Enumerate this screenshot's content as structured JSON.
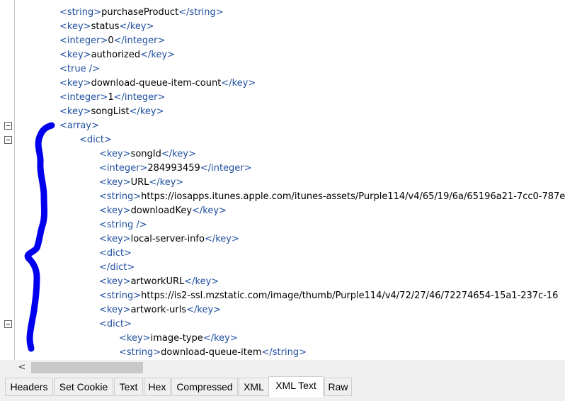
{
  "lines": [
    {
      "kind": "pair",
      "tag": "string",
      "text": "purchaseProduct"
    },
    {
      "kind": "pair",
      "tag": "key",
      "text": "status"
    },
    {
      "kind": "pair",
      "tag": "integer",
      "text": "0"
    },
    {
      "kind": "pair",
      "tag": "key",
      "text": "authorized"
    },
    {
      "kind": "self",
      "tag": "true"
    },
    {
      "kind": "pair",
      "tag": "key",
      "text": "download-queue-item-count"
    },
    {
      "kind": "pair",
      "tag": "integer",
      "text": "1"
    },
    {
      "kind": "pair",
      "tag": "key",
      "text": "songList"
    },
    {
      "kind": "open",
      "tag": "array"
    },
    {
      "kind": "open",
      "tag": "dict"
    },
    {
      "kind": "pair",
      "tag": "key",
      "text": "songId"
    },
    {
      "kind": "pair",
      "tag": "integer",
      "text": "284993459"
    },
    {
      "kind": "pair",
      "tag": "key",
      "text": "URL"
    },
    {
      "kind": "open-text",
      "tag": "string",
      "text": "https://iosapps.itunes.apple.com/itunes-assets/Purple114/v4/65/19/6a/65196a21-7cc0-787e"
    },
    {
      "kind": "pair",
      "tag": "key",
      "text": "downloadKey"
    },
    {
      "kind": "self",
      "tag": "string"
    },
    {
      "kind": "pair",
      "tag": "key",
      "text": "local-server-info"
    },
    {
      "kind": "open",
      "tag": "dict"
    },
    {
      "kind": "close",
      "tag": "dict"
    },
    {
      "kind": "pair",
      "tag": "key",
      "text": "artworkURL"
    },
    {
      "kind": "open-text",
      "tag": "string",
      "text": "https://is2-ssl.mzstatic.com/image/thumb/Purple114/v4/72/27/46/72274654-15a1-237c-16"
    },
    {
      "kind": "pair",
      "tag": "key",
      "text": "artwork-urls"
    },
    {
      "kind": "open",
      "tag": "dict"
    },
    {
      "kind": "pair",
      "tag": "key",
      "text": "image-type"
    },
    {
      "kind": "pair",
      "tag": "string",
      "text": "download-queue-item"
    }
  ],
  "tabs": [
    {
      "label": "Headers",
      "active": false
    },
    {
      "label": "Set Cookie",
      "active": false
    },
    {
      "label": "Text",
      "active": false
    },
    {
      "label": "Hex",
      "active": false
    },
    {
      "label": "Compressed",
      "active": false
    },
    {
      "label": "XML",
      "active": false
    },
    {
      "label": "XML Text",
      "active": true
    },
    {
      "label": "Raw",
      "active": false
    }
  ],
  "scrollbar": {
    "left_arrow": "<"
  },
  "icons": {
    "fold": "collapse-minus-icon",
    "scroll_left": "chevron-left-icon"
  },
  "colors": {
    "tag": "#1f4fa0",
    "text": "#000000",
    "annotation": "#0000ee"
  }
}
